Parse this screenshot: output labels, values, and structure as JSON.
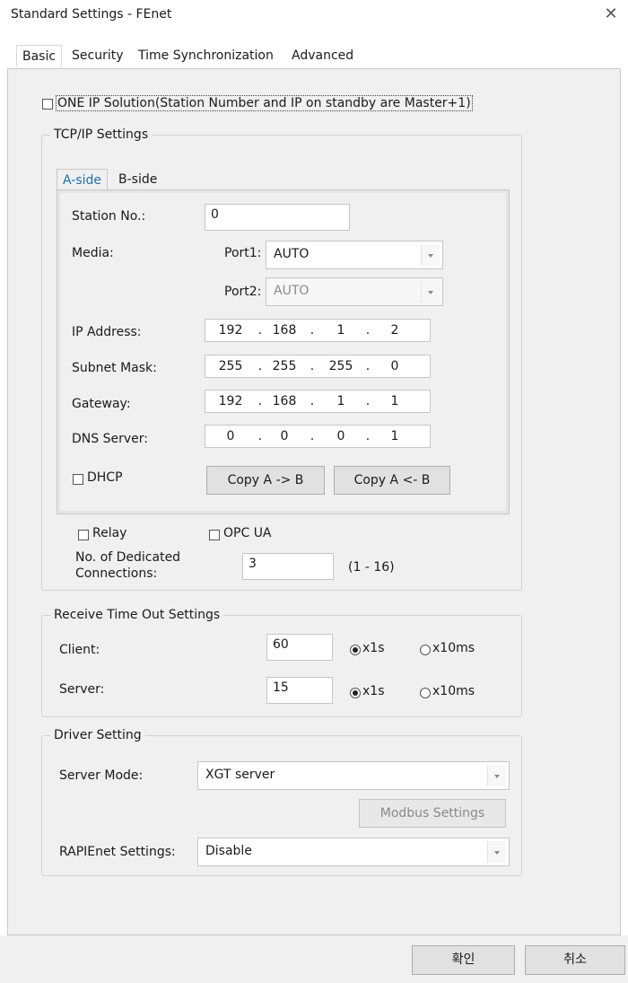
{
  "window": {
    "title": "Standard Settings - FEnet",
    "close_glyph": "✕"
  },
  "tabs": [
    {
      "label": "Basic",
      "active": true
    },
    {
      "label": "Security",
      "active": false
    },
    {
      "label": "Time Synchronization",
      "active": false
    },
    {
      "label": "Advanced",
      "active": false
    }
  ],
  "one_ip": {
    "label": "ONE IP Solution(Station Number and IP on standby are Master+1)",
    "checked": false
  },
  "tcpip": {
    "legend": "TCP/IP Settings",
    "subtabs": [
      {
        "label": "A-side",
        "active": true
      },
      {
        "label": "B-side",
        "active": false
      }
    ],
    "station_label": "Station No.:",
    "station_value": "0",
    "media_label": "Media:",
    "port1_label": "Port1:",
    "port1_value": "AUTO",
    "port2_label": "Port2:",
    "port2_value": "AUTO",
    "ip_label": "IP Address:",
    "ip": [
      "192",
      "168",
      "1",
      "2"
    ],
    "subnet_label": "Subnet Mask:",
    "subnet": [
      "255",
      "255",
      "255",
      "0"
    ],
    "gateway_label": "Gateway:",
    "gateway": [
      "192",
      "168",
      "1",
      "1"
    ],
    "dns_label": "DNS Server:",
    "dns": [
      "0",
      "0",
      "0",
      "1"
    ],
    "dot": ".",
    "dhcp_label": "DHCP",
    "copy_a_to_b": "Copy A -> B",
    "copy_b_to_a": "Copy A <- B",
    "relay_label": "Relay",
    "opcua_label": "OPC UA",
    "dedicated_label_1": "No. of Dedicated",
    "dedicated_label_2": "Connections:",
    "dedicated_value": "3",
    "dedicated_range": "(1 - 16)"
  },
  "timeout": {
    "legend": "Receive Time Out Settings",
    "client_label": "Client:",
    "client_value": "60",
    "server_label": "Server:",
    "server_value": "15",
    "unit_x1s": "x1s",
    "unit_x10ms": "x10ms",
    "client_unit_selected": "x1s",
    "server_unit_selected": "x1s"
  },
  "driver": {
    "legend": "Driver Setting",
    "server_mode_label": "Server Mode:",
    "server_mode_value": "XGT server",
    "modbus_button": "Modbus Settings",
    "rapienet_label": "RAPIEnet Settings:",
    "rapienet_value": "Disable"
  },
  "footer": {
    "ok": "확인",
    "cancel": "취소"
  }
}
